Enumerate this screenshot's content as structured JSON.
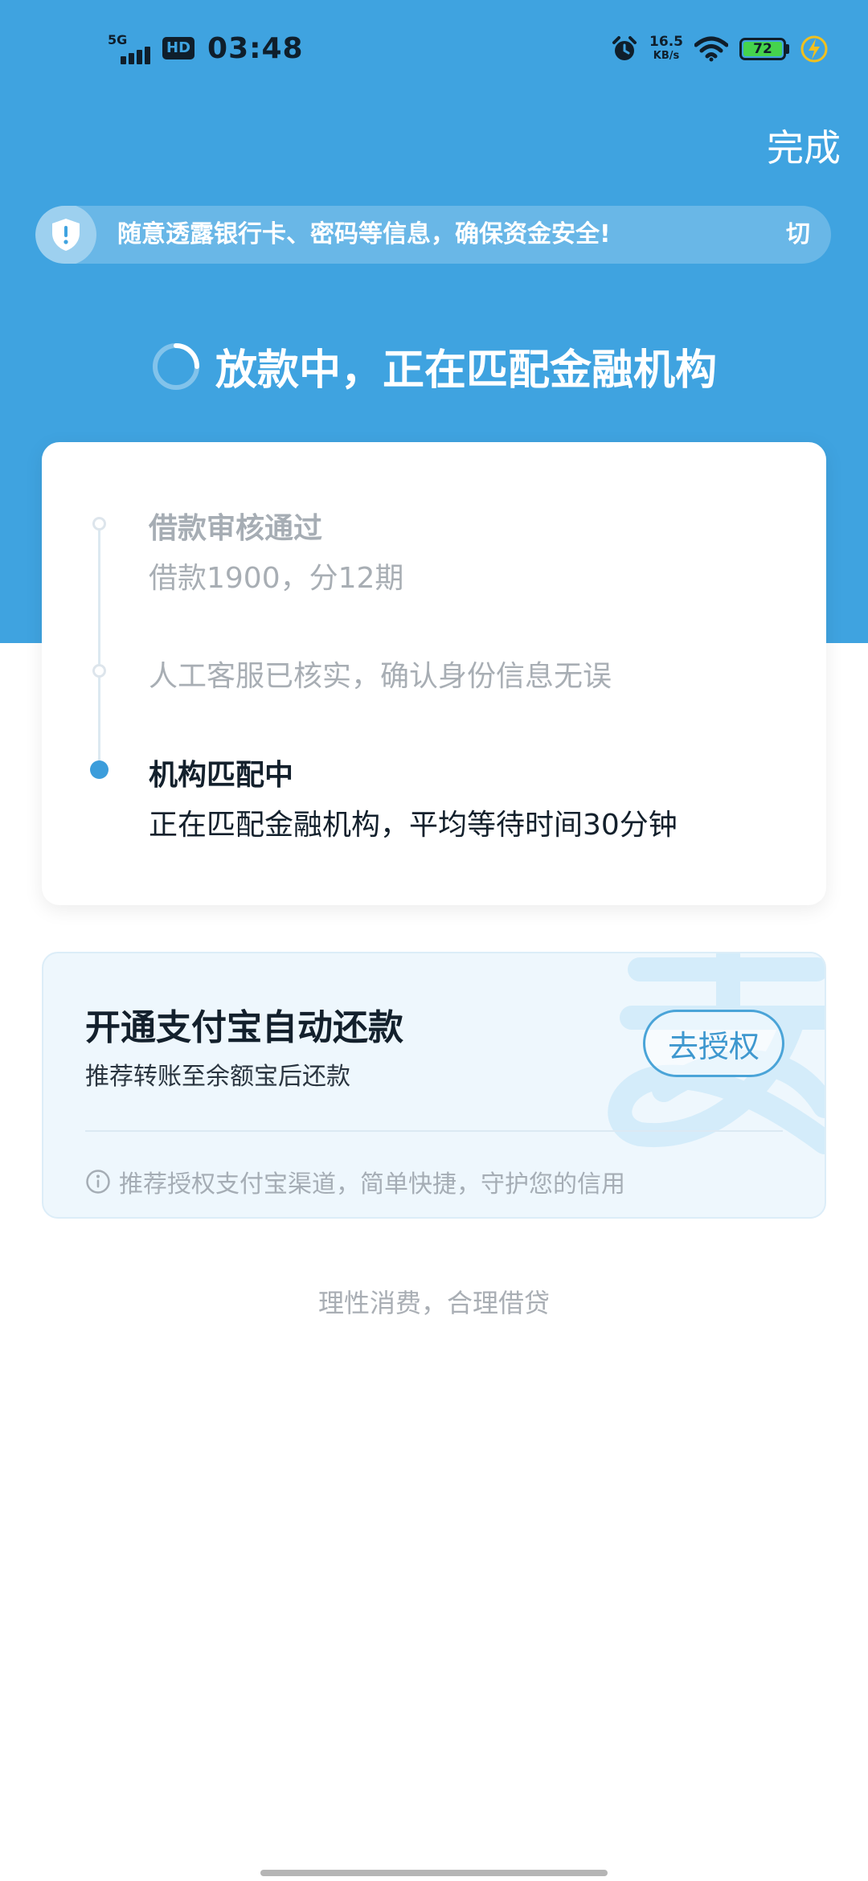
{
  "status_bar": {
    "network": "5G",
    "hd": "HD",
    "time": "03:48",
    "speed_value": "16.5",
    "speed_unit": "KB/s",
    "battery": "72"
  },
  "header": {
    "done_label": "完成"
  },
  "notice": {
    "text": "随意透露银行卡、密码等信息，确保资金安全!",
    "fragment": "切"
  },
  "status": {
    "headline": "放款中，正在匹配金融机构"
  },
  "steps": [
    {
      "title": "借款审核通过",
      "desc": "借款1900，分12期",
      "state": "done"
    },
    {
      "title": "人工客服已核实，确认身份信息无误",
      "state": "done"
    },
    {
      "title": "机构匹配中",
      "desc": "正在匹配金融机构，平均等待时间30分钟",
      "state": "active"
    }
  ],
  "alipay": {
    "title": "开通支付宝自动还款",
    "subtitle": "推荐转账至余额宝后还款",
    "button": "去授权",
    "tip": "推荐授权支付宝渠道，简单快捷，守护您的信用"
  },
  "footer": {
    "slogan": "理性消费，合理借贷"
  },
  "colors": {
    "primary": "#3fa3e0",
    "accent": "#3c9ddb",
    "battery": "#45d34d"
  }
}
